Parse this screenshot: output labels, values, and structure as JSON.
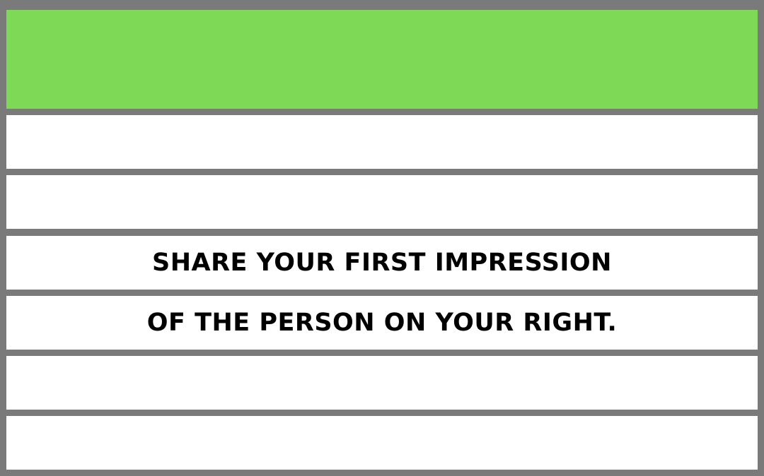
{
  "card": {
    "header_color": "#7ed957",
    "lines": [
      "",
      "",
      "SHARE YOUR FIRST IMPRESSION",
      "OF THE PERSON ON YOUR RIGHT.",
      "",
      ""
    ]
  }
}
